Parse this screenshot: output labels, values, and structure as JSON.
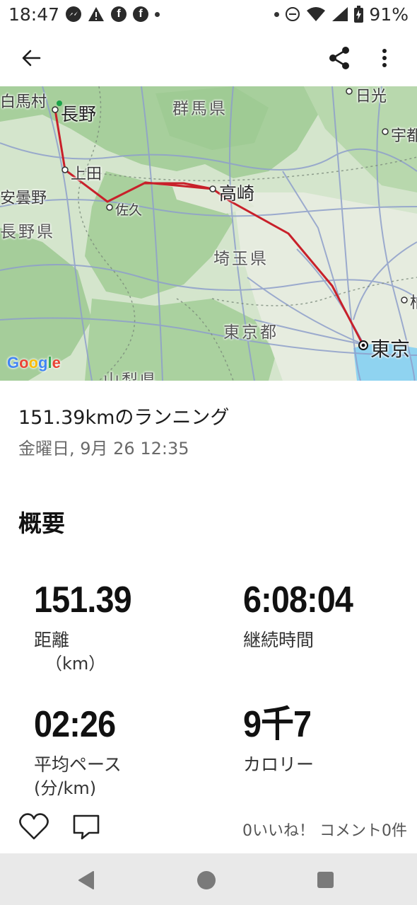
{
  "status_bar": {
    "time": "18:47",
    "battery": "91%",
    "icons": [
      "messenger-icon",
      "alert-icon",
      "facebook-icon",
      "facebook-icon",
      "dot-icon",
      "dot-icon",
      "do-not-disturb-icon",
      "wifi-icon",
      "signal-icon",
      "battery-icon"
    ]
  },
  "app_bar": {
    "back_icon": "arrow-left-icon",
    "share_icon": "share-icon",
    "more_icon": "more-vert-icon"
  },
  "map": {
    "places": {
      "hakuba": "白馬村",
      "nagano": "長野",
      "gunma": "群馬県",
      "nikko": "日光",
      "utsunomiya": "宇都",
      "ueda": "上田",
      "azumino": "安曇野",
      "takasaki": "高崎",
      "saku": "佐久",
      "nagano_pref": "長野県",
      "saitama": "埼玉県",
      "tokyo_to": "東京都",
      "tokyo": "東京",
      "yamanashi": "山梨県",
      "edge_kanji": "柏"
    },
    "attribution": "Google",
    "route_color": "#c8202a"
  },
  "activity": {
    "title": "151.39kmのランニング",
    "date": "金曜日, 9月 26 12:35"
  },
  "overview": {
    "heading": "概要",
    "distance": {
      "value": "151.39",
      "label": "距離",
      "unit": "（km）"
    },
    "duration": {
      "value": "6:08:04",
      "label": "継続時間"
    },
    "pace": {
      "value": "02:26",
      "label": "平均ペース",
      "unit": "(分/km)"
    },
    "calories": {
      "value": "9千7",
      "label": "カロリー"
    }
  },
  "social": {
    "like_icon": "heart-icon",
    "comment_icon": "comment-icon",
    "counts": "0いいね！ コメント0件"
  },
  "nav_bar": {
    "back": "nav-back-icon",
    "home": "nav-home-icon",
    "recents": "nav-recents-icon"
  }
}
